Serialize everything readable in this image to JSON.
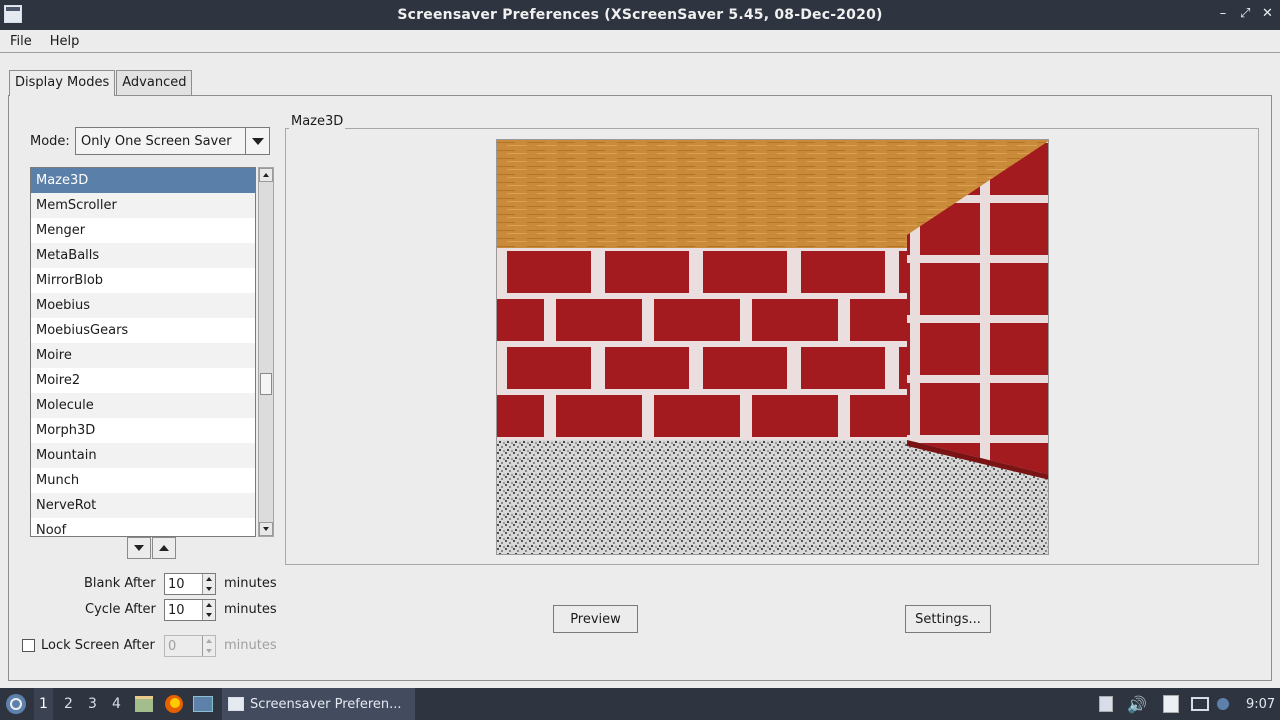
{
  "window": {
    "title": "Screensaver Preferences  (XScreenSaver 5.45, 08-Dec-2020)",
    "controls": [
      "–",
      "⤢",
      "✕"
    ]
  },
  "menubar": {
    "file": "File",
    "help": "Help"
  },
  "tabs": {
    "display_modes": "Display Modes",
    "advanced": "Advanced"
  },
  "mode": {
    "label": "Mode:",
    "value": "Only One Screen Saver"
  },
  "savers": [
    "Maze3D",
    "MemScroller",
    "Menger",
    "MetaBalls",
    "MirrorBlob",
    "Moebius",
    "MoebiusGears",
    "Moire",
    "Moire2",
    "Molecule",
    "Morph3D",
    "Mountain",
    "Munch",
    "NerveRot",
    "Noof"
  ],
  "selected_saver": "Maze3D",
  "blank_after": {
    "label": "Blank After",
    "value": "10",
    "unit": "minutes"
  },
  "cycle_after": {
    "label": "Cycle After",
    "value": "10",
    "unit": "minutes"
  },
  "lock_screen": {
    "label": "Lock Screen After",
    "value": "0",
    "unit": "minutes",
    "checked": false
  },
  "preview_frame": {
    "label": "Maze3D"
  },
  "buttons": {
    "preview": "Preview",
    "settings": "Settings..."
  },
  "taskbar": {
    "workspaces": [
      "1",
      "2",
      "3",
      "4"
    ],
    "active_workspace": "1",
    "task_label": "Screensaver Preferen...",
    "clock": "9:07"
  },
  "colors": {
    "titlebar": "#2e3440",
    "selection": "#5a7fa8",
    "brick": "#9b1c1c",
    "ceiling": "#c98a3a"
  }
}
